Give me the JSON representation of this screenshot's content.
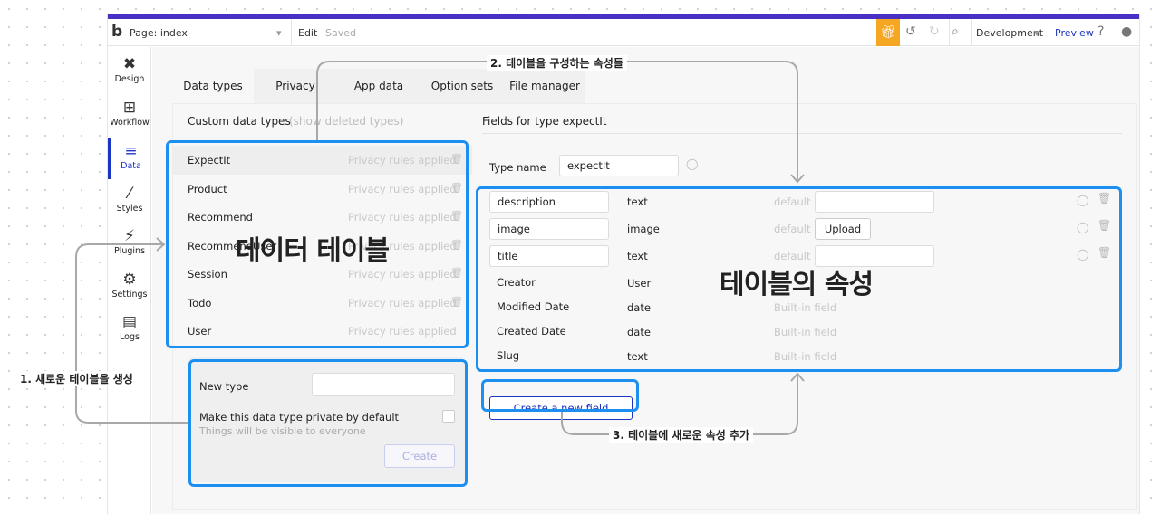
{
  "topbar": {
    "logo": "b",
    "page_label": "Page: index",
    "edit_label": "Edit",
    "saved_label": "Saved",
    "env_label": "Development",
    "preview_label": "Preview"
  },
  "sidebar": {
    "items": [
      {
        "label": "Design",
        "icon": "design-icon"
      },
      {
        "label": "Workflow",
        "icon": "workflow-icon"
      },
      {
        "label": "Data",
        "icon": "database-icon"
      },
      {
        "label": "Styles",
        "icon": "brush-icon"
      },
      {
        "label": "Plugins",
        "icon": "plug-icon"
      },
      {
        "label": "Settings",
        "icon": "gear-icon"
      },
      {
        "label": "Logs",
        "icon": "document-icon"
      }
    ],
    "active": "Data"
  },
  "tabs": [
    "Data types",
    "Privacy",
    "App data",
    "Option sets",
    "File manager"
  ],
  "left_col": {
    "title": "Custom data types",
    "show_deleted": "(show deleted types)",
    "privacy_text": "Privacy rules applied",
    "types": [
      "ExpectIt",
      "Product",
      "Recommend",
      "RecommendUser",
      "Session",
      "Todo",
      "User"
    ]
  },
  "new_type": {
    "label": "New type",
    "private_label": "Make this data type private by default",
    "private_sub": "Things will be visible to everyone",
    "create_label": "Create"
  },
  "right_col": {
    "title": "Fields for type expectIt",
    "type_name_label": "Type name",
    "type_name_value": "expectIt",
    "default_label": "default",
    "upload_label": "Upload",
    "builtin_label": "Built-in field",
    "fields": [
      {
        "name": "description",
        "type": "text"
      },
      {
        "name": "image",
        "type": "image"
      },
      {
        "name": "title",
        "type": "text"
      },
      {
        "name": "Creator",
        "type": "User"
      },
      {
        "name": "Modified Date",
        "type": "date"
      },
      {
        "name": "Created Date",
        "type": "date"
      },
      {
        "name": "Slug",
        "type": "text"
      }
    ],
    "create_field_label": "Create a new field"
  },
  "annotations": {
    "a1": "1. 새로운 테이블을 생성",
    "a2": "2. 테이블을 구성하는 속성들",
    "a3": "3. 테이블에 새로운 속성 추가",
    "big_tables": "데이터 테이블",
    "big_fields": "테이블의 속성"
  },
  "colors": {
    "accent": "#1a34c4",
    "purple_bar": "#4a2fc4",
    "highlight_box": "#1d8ff0",
    "gift": "#f5a623"
  }
}
